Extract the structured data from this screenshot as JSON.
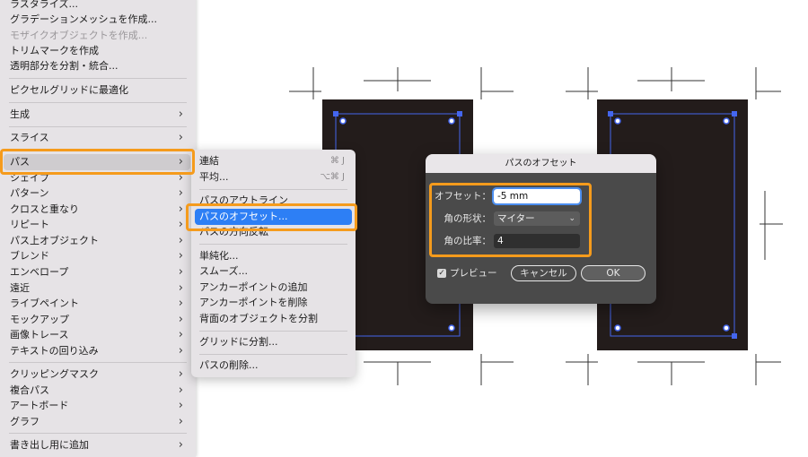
{
  "menu": {
    "items": [
      {
        "label": "ラスタライズ...",
        "arrow": ""
      },
      {
        "label": "グラデーションメッシュを作成...",
        "arrow": ""
      },
      {
        "label": "モザイクオブジェクトを作成...",
        "arrow": "",
        "disabled": true
      },
      {
        "label": "トリムマークを作成",
        "arrow": ""
      },
      {
        "label": "透明部分を分割・統合...",
        "arrow": ""
      },
      {
        "label": "ピクセルグリッドに最適化",
        "arrow": ""
      },
      {
        "label": "生成",
        "arrow": "›"
      },
      {
        "label": "スライス",
        "arrow": "›"
      },
      {
        "label": "パス",
        "arrow": "›"
      },
      {
        "label": "シェイプ",
        "arrow": "›"
      },
      {
        "label": "パターン",
        "arrow": "›"
      },
      {
        "label": "クロスと重なり",
        "arrow": "›"
      },
      {
        "label": "リピート",
        "arrow": "›"
      },
      {
        "label": "パス上オブジェクト",
        "arrow": "›"
      },
      {
        "label": "ブレンド",
        "arrow": "›"
      },
      {
        "label": "エンベロープ",
        "arrow": "›"
      },
      {
        "label": "遠近",
        "arrow": "›"
      },
      {
        "label": "ライブペイント",
        "arrow": "›"
      },
      {
        "label": "モックアップ",
        "arrow": "›"
      },
      {
        "label": "画像トレース",
        "arrow": "›"
      },
      {
        "label": "テキストの回り込み",
        "arrow": "›"
      },
      {
        "label": "クリッピングマスク",
        "arrow": "›"
      },
      {
        "label": "複合パス",
        "arrow": "›"
      },
      {
        "label": "アートボード",
        "arrow": "›"
      },
      {
        "label": "グラフ",
        "arrow": "›"
      },
      {
        "label": "書き出し用に追加",
        "arrow": "›"
      }
    ]
  },
  "submenu": {
    "items": [
      {
        "label": "連結",
        "shortcut": "⌘ J"
      },
      {
        "label": "平均...",
        "shortcut": "⌥⌘ J"
      },
      {
        "label": "パスのアウトライン",
        "shortcut": ""
      },
      {
        "label": "パスのオフセット...",
        "shortcut": ""
      },
      {
        "label": "パスの方向反転",
        "shortcut": ""
      },
      {
        "label": "単純化...",
        "shortcut": ""
      },
      {
        "label": "スムーズ...",
        "shortcut": ""
      },
      {
        "label": "アンカーポイントの追加",
        "shortcut": ""
      },
      {
        "label": "アンカーポイントを削除",
        "shortcut": ""
      },
      {
        "label": "背面のオブジェクトを分割",
        "shortcut": ""
      },
      {
        "label": "グリッドに分割...",
        "shortcut": ""
      },
      {
        "label": "パスの削除...",
        "shortcut": ""
      }
    ]
  },
  "dialog": {
    "title": "パスのオフセット",
    "offset_label": "オフセット：",
    "offset_value": "-5 mm",
    "corner_label": "角の形状：",
    "corner_value": "マイター",
    "ratio_label": "角の比率：",
    "ratio_value": "4",
    "preview_label": "プレビュー",
    "preview_checked": true,
    "cancel_label": "キャンセル",
    "ok_label": "OK"
  },
  "colors": {
    "highlight": "#f59b1c",
    "selection": "#2d7ff5",
    "card": "#231c1b",
    "path": "#3b5bdb"
  }
}
